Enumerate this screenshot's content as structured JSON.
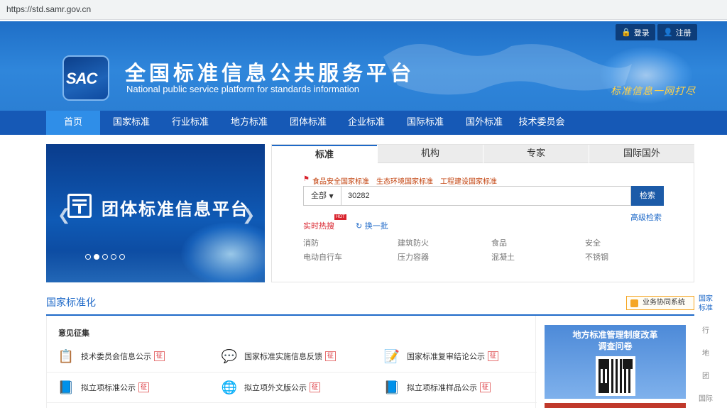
{
  "browser": {
    "url": "https://std.samr.gov.cn"
  },
  "header": {
    "logo_text": "SAC",
    "title": "全国标准信息公共服务平台",
    "subtitle": "National public service platform  for standards information",
    "slogan": "标准信息一网打尽",
    "login_label": "登录",
    "register_label": "注册"
  },
  "nav": [
    "首页",
    "国家标准",
    "行业标准",
    "地方标准",
    "团体标准",
    "企业标准",
    "国际标准",
    "国外标准",
    "技术委员会"
  ],
  "banner": {
    "text": "团体标准信息平台",
    "slides": 5,
    "active_slide": 1
  },
  "search": {
    "tabs": [
      "标准",
      "机构",
      "专家",
      "国际国外"
    ],
    "quick_links": [
      "食品安全国家标准",
      "生态环境国家标准",
      "工程建设国家标准"
    ],
    "scope": "全部",
    "query": "30282",
    "button": "检索",
    "advanced": "高级检索",
    "hot_label": "实时热搜",
    "hot_badge": "HOT",
    "refresh": "换一批",
    "hot_terms": [
      "消防",
      "建筑防火",
      "食品",
      "安全",
      "电动自行车",
      "压力容器",
      "混凝土",
      "不锈钢"
    ]
  },
  "section": {
    "title": "国家标准化",
    "biz_button": "业务协同系统",
    "box_title": "意见征集",
    "tag": "征",
    "items": [
      "技术委员会信息公示",
      "国家标准实施信息反馈",
      "国家标准复审结论公示",
      "拟立项标准公示",
      "拟立项外文版公示",
      "拟立项标准样品公示"
    ]
  },
  "promo": {
    "line1": "地方标准管理制度改革",
    "line2": "调查问卷"
  },
  "side_nav": [
    "国家标准",
    "行",
    "地",
    "团",
    "国际"
  ],
  "colors": {
    "primary": "#1e69c8",
    "nav": "#1659b6",
    "accent": "#d9232d"
  }
}
